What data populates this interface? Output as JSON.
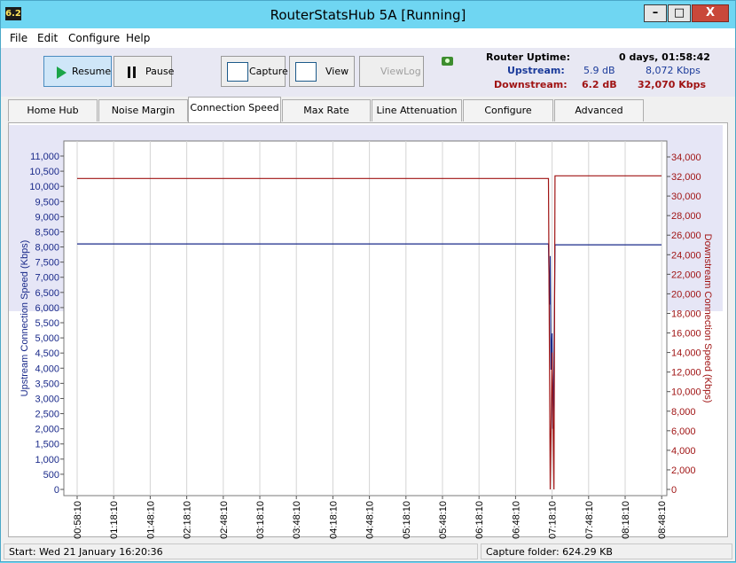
{
  "window": {
    "icon_text": "6.2",
    "title": "RouterStatsHub 5A  [Running]",
    "buttons": {
      "minimize": "–",
      "maximize": "□",
      "close": "X"
    }
  },
  "menu": [
    "File",
    "Edit",
    "Configure",
    "Help"
  ],
  "toolbar": {
    "resume": "Resume",
    "pause": "Pause",
    "capture": "Capture",
    "view": "View",
    "viewlog": "ViewLog"
  },
  "stats": {
    "uptime_label": "Router Uptime:",
    "uptime_value": "0 days, 01:58:42",
    "upstream_label": "Upstream:",
    "upstream_db": "5.9 dB",
    "upstream_kbps": "8,072 Kbps",
    "downstream_label": "Downstream:",
    "downstream_db": "6.2 dB",
    "downstream_kbps": "32,070 Kbps",
    "upstream_color": "#1a3a9a",
    "downstream_color": "#a01414"
  },
  "tabs": [
    "Home Hub",
    "Noise Margin",
    "Connection Speed",
    "Max Rate",
    "Line Attenuation",
    "Configure",
    "Advanced"
  ],
  "active_tab": "Connection Speed",
  "chart_data": {
    "type": "line",
    "x": [
      "00:58:10",
      "01:18:10",
      "01:48:10",
      "02:18:10",
      "02:48:10",
      "03:18:10",
      "03:48:10",
      "04:18:10",
      "04:48:10",
      "05:18:10",
      "05:48:10",
      "06:18:10",
      "06:48:10",
      "07:18:10",
      "07:48:10",
      "08:18:10",
      "08:48:10"
    ],
    "ylabel": "Upstream Connection Speed (Kbps)",
    "y2label": "Downstream Connection Speed (Kbps)",
    "ylim": [
      0,
      11000
    ],
    "y2lim": [
      0,
      34000
    ],
    "yticks": [
      "11,000",
      "10,500",
      "10,000",
      "9,500",
      "9,000",
      "8,500",
      "8,000",
      "7,500",
      "7,000",
      "6,500",
      "6,000",
      "5,500",
      "5,000",
      "4,500",
      "4,000",
      "3,500",
      "3,000",
      "2,500",
      "2,000",
      "1,500",
      "1,000",
      "500",
      "0"
    ],
    "y2ticks": [
      "34,000",
      "32,000",
      "30,000",
      "28,000",
      "26,000",
      "24,000",
      "22,000",
      "20,000",
      "18,000",
      "16,000",
      "14,000",
      "12,000",
      "10,000",
      "8,000",
      "6,000",
      "4,000",
      "2,000",
      "0"
    ],
    "grid": true,
    "series": [
      {
        "name": "Upstream",
        "axis": "left",
        "color": "#1a2a8a",
        "points": [
          [
            0,
            8100
          ],
          [
            12.9,
            8100
          ],
          [
            12.93,
            6100
          ],
          [
            12.95,
            7700
          ],
          [
            12.97,
            3950
          ],
          [
            13.0,
            5150
          ],
          [
            13.02,
            2000
          ],
          [
            13.05,
            4100
          ],
          [
            13.08,
            8072
          ],
          [
            16,
            8072
          ]
        ]
      },
      {
        "name": "Downstream",
        "axis": "right",
        "color": "#a01414",
        "points": [
          [
            0,
            31800
          ],
          [
            12.9,
            31800
          ],
          [
            12.95,
            0
          ],
          [
            13.0,
            14000
          ],
          [
            13.05,
            0
          ],
          [
            13.08,
            32070
          ],
          [
            16,
            32070
          ]
        ]
      }
    ]
  },
  "statusbar": {
    "start": "Start: Wed 21 January 16:20:36",
    "capture_folder": "Capture folder:  624.29 KB"
  }
}
